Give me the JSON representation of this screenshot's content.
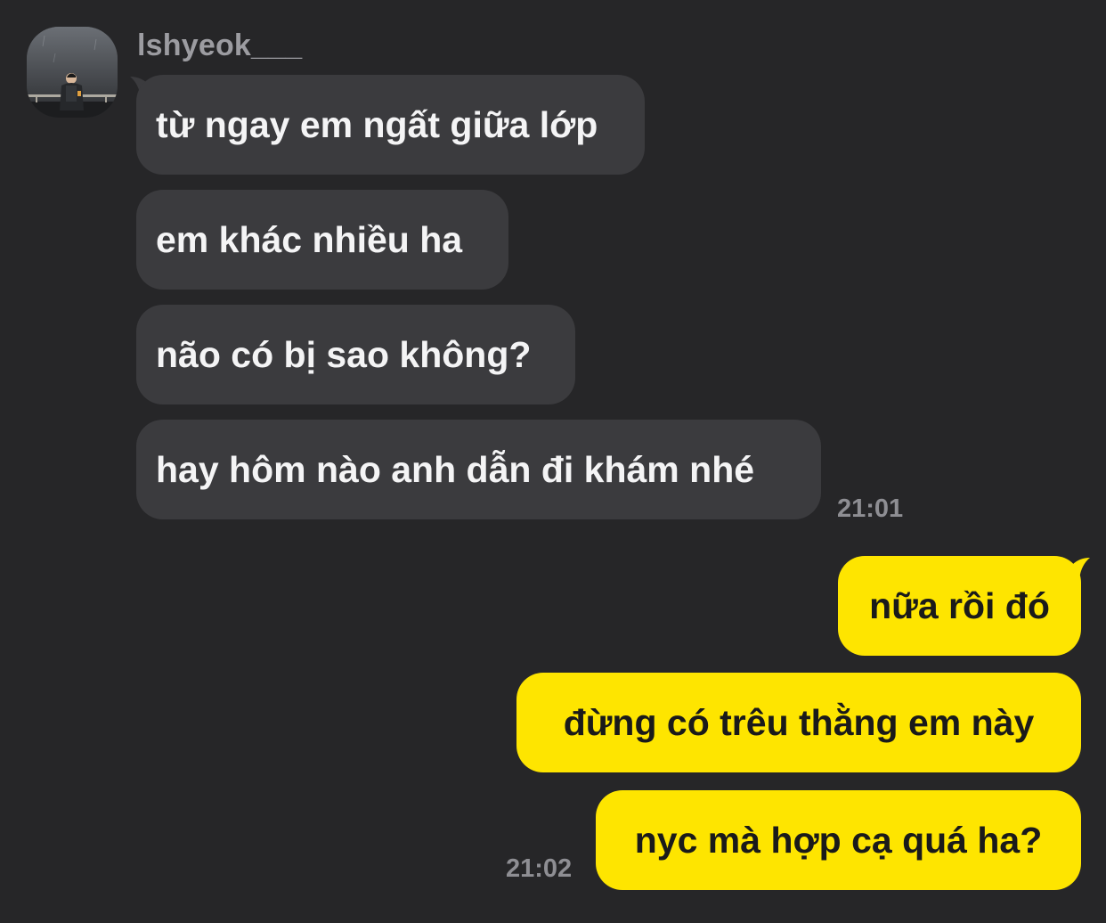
{
  "sender": {
    "name": "lshyeok___",
    "avatar_icon": "profile-photo-icon"
  },
  "incoming": {
    "messages": [
      "từ ngay em ngất giữa lớp",
      "em khác nhiều ha",
      "não có bị sao không?",
      "hay hôm nào anh dẫn đi khám nhé"
    ],
    "time": "21:01"
  },
  "outgoing": {
    "messages": [
      "nữa rồi đó",
      "đừng có trêu thằng em này",
      "nyc mà hợp cạ quá ha?"
    ],
    "time": "21:02"
  },
  "colors": {
    "background": "#262628",
    "incoming_bubble": "#3b3b3e",
    "outgoing_bubble": "#fee500",
    "timestamp": "#8e8e93",
    "sender_name": "#9c9ca1"
  }
}
